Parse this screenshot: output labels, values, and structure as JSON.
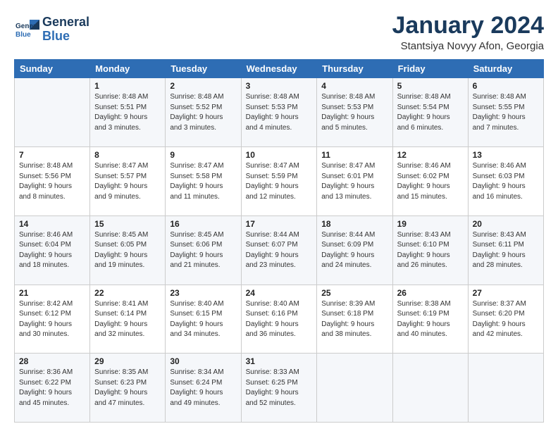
{
  "header": {
    "logo_line1": "General",
    "logo_line2": "Blue",
    "month": "January 2024",
    "location": "Stantsiya Novyy Afon, Georgia"
  },
  "weekdays": [
    "Sunday",
    "Monday",
    "Tuesday",
    "Wednesday",
    "Thursday",
    "Friday",
    "Saturday"
  ],
  "weeks": [
    [
      {
        "num": "",
        "info": ""
      },
      {
        "num": "1",
        "info": "Sunrise: 8:48 AM\nSunset: 5:51 PM\nDaylight: 9 hours\nand 3 minutes."
      },
      {
        "num": "2",
        "info": "Sunrise: 8:48 AM\nSunset: 5:52 PM\nDaylight: 9 hours\nand 3 minutes."
      },
      {
        "num": "3",
        "info": "Sunrise: 8:48 AM\nSunset: 5:53 PM\nDaylight: 9 hours\nand 4 minutes."
      },
      {
        "num": "4",
        "info": "Sunrise: 8:48 AM\nSunset: 5:53 PM\nDaylight: 9 hours\nand 5 minutes."
      },
      {
        "num": "5",
        "info": "Sunrise: 8:48 AM\nSunset: 5:54 PM\nDaylight: 9 hours\nand 6 minutes."
      },
      {
        "num": "6",
        "info": "Sunrise: 8:48 AM\nSunset: 5:55 PM\nDaylight: 9 hours\nand 7 minutes."
      }
    ],
    [
      {
        "num": "7",
        "info": "Sunrise: 8:48 AM\nSunset: 5:56 PM\nDaylight: 9 hours\nand 8 minutes."
      },
      {
        "num": "8",
        "info": "Sunrise: 8:47 AM\nSunset: 5:57 PM\nDaylight: 9 hours\nand 9 minutes."
      },
      {
        "num": "9",
        "info": "Sunrise: 8:47 AM\nSunset: 5:58 PM\nDaylight: 9 hours\nand 11 minutes."
      },
      {
        "num": "10",
        "info": "Sunrise: 8:47 AM\nSunset: 5:59 PM\nDaylight: 9 hours\nand 12 minutes."
      },
      {
        "num": "11",
        "info": "Sunrise: 8:47 AM\nSunset: 6:01 PM\nDaylight: 9 hours\nand 13 minutes."
      },
      {
        "num": "12",
        "info": "Sunrise: 8:46 AM\nSunset: 6:02 PM\nDaylight: 9 hours\nand 15 minutes."
      },
      {
        "num": "13",
        "info": "Sunrise: 8:46 AM\nSunset: 6:03 PM\nDaylight: 9 hours\nand 16 minutes."
      }
    ],
    [
      {
        "num": "14",
        "info": "Sunrise: 8:46 AM\nSunset: 6:04 PM\nDaylight: 9 hours\nand 18 minutes."
      },
      {
        "num": "15",
        "info": "Sunrise: 8:45 AM\nSunset: 6:05 PM\nDaylight: 9 hours\nand 19 minutes."
      },
      {
        "num": "16",
        "info": "Sunrise: 8:45 AM\nSunset: 6:06 PM\nDaylight: 9 hours\nand 21 minutes."
      },
      {
        "num": "17",
        "info": "Sunrise: 8:44 AM\nSunset: 6:07 PM\nDaylight: 9 hours\nand 23 minutes."
      },
      {
        "num": "18",
        "info": "Sunrise: 8:44 AM\nSunset: 6:09 PM\nDaylight: 9 hours\nand 24 minutes."
      },
      {
        "num": "19",
        "info": "Sunrise: 8:43 AM\nSunset: 6:10 PM\nDaylight: 9 hours\nand 26 minutes."
      },
      {
        "num": "20",
        "info": "Sunrise: 8:43 AM\nSunset: 6:11 PM\nDaylight: 9 hours\nand 28 minutes."
      }
    ],
    [
      {
        "num": "21",
        "info": "Sunrise: 8:42 AM\nSunset: 6:12 PM\nDaylight: 9 hours\nand 30 minutes."
      },
      {
        "num": "22",
        "info": "Sunrise: 8:41 AM\nSunset: 6:14 PM\nDaylight: 9 hours\nand 32 minutes."
      },
      {
        "num": "23",
        "info": "Sunrise: 8:40 AM\nSunset: 6:15 PM\nDaylight: 9 hours\nand 34 minutes."
      },
      {
        "num": "24",
        "info": "Sunrise: 8:40 AM\nSunset: 6:16 PM\nDaylight: 9 hours\nand 36 minutes."
      },
      {
        "num": "25",
        "info": "Sunrise: 8:39 AM\nSunset: 6:18 PM\nDaylight: 9 hours\nand 38 minutes."
      },
      {
        "num": "26",
        "info": "Sunrise: 8:38 AM\nSunset: 6:19 PM\nDaylight: 9 hours\nand 40 minutes."
      },
      {
        "num": "27",
        "info": "Sunrise: 8:37 AM\nSunset: 6:20 PM\nDaylight: 9 hours\nand 42 minutes."
      }
    ],
    [
      {
        "num": "28",
        "info": "Sunrise: 8:36 AM\nSunset: 6:22 PM\nDaylight: 9 hours\nand 45 minutes."
      },
      {
        "num": "29",
        "info": "Sunrise: 8:35 AM\nSunset: 6:23 PM\nDaylight: 9 hours\nand 47 minutes."
      },
      {
        "num": "30",
        "info": "Sunrise: 8:34 AM\nSunset: 6:24 PM\nDaylight: 9 hours\nand 49 minutes."
      },
      {
        "num": "31",
        "info": "Sunrise: 8:33 AM\nSunset: 6:25 PM\nDaylight: 9 hours\nand 52 minutes."
      },
      {
        "num": "",
        "info": ""
      },
      {
        "num": "",
        "info": ""
      },
      {
        "num": "",
        "info": ""
      }
    ]
  ]
}
